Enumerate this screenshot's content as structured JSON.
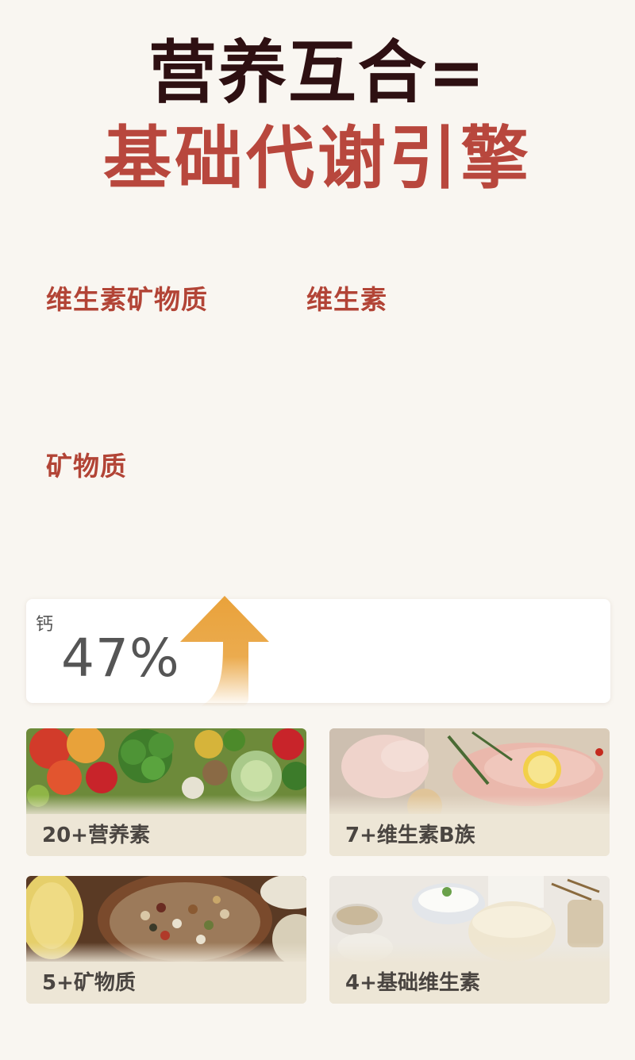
{
  "header": {
    "title_line1": "营养互合=",
    "title_line2": "基础代谢引擎"
  },
  "sections": {
    "vitamin_mineral": "维生素矿物质",
    "vitamin": "维生素",
    "mineral": "矿物质"
  },
  "stat": {
    "name": "钙",
    "value": "47%",
    "arrow_color": "#e9a23b"
  },
  "tiles": [
    {
      "label": "20+营养素",
      "image": "vegetables-photo"
    },
    {
      "label": "7+维生素B族",
      "image": "chicken-breast-photo"
    },
    {
      "label": "5+矿物质",
      "image": "beans-grains-photo"
    },
    {
      "label": "4+基础维生素",
      "image": "dairy-photo"
    }
  ],
  "colors": {
    "title_dark": "#2e1012",
    "accent_red": "#b8473d",
    "background": "#f9f6f1"
  }
}
